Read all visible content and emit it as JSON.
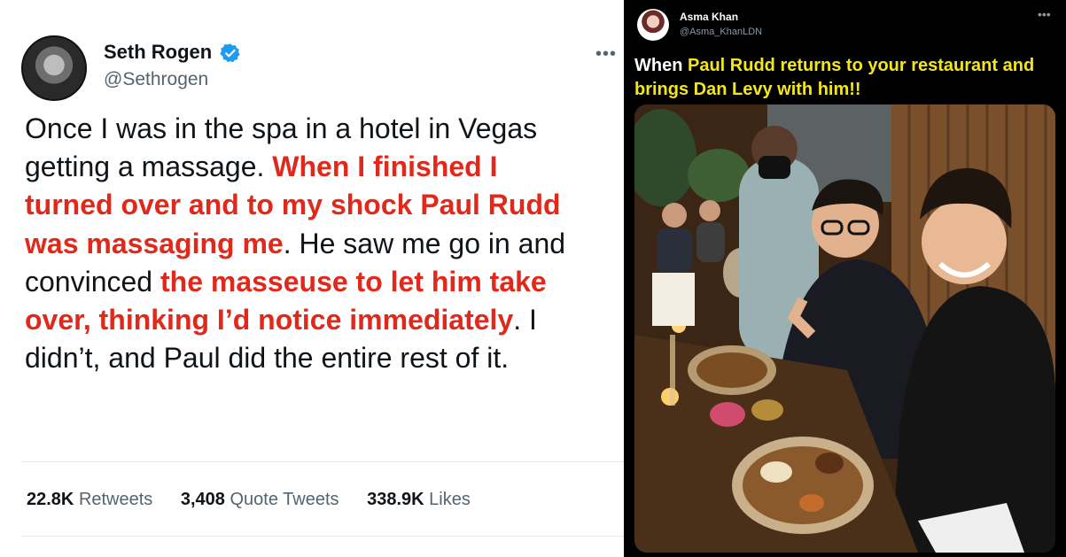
{
  "left_tweet": {
    "author_name": "Seth Rogen",
    "handle": "@Sethrogen",
    "more_glyph": "•••",
    "text_segments": [
      {
        "text": "Once I was in the spa in a hotel in Vegas getting a massage. ",
        "highlight": false
      },
      {
        "text": "When I finished I turned over and to my shock Paul Rudd was massaging me",
        "highlight": true
      },
      {
        "text": ". He saw me go in and convinced ",
        "highlight": false
      },
      {
        "text": "the masseuse to let him take over, thinking I’d notice immediately",
        "highlight": true
      },
      {
        "text": ". I didn’t, and Paul did the entire rest of it.",
        "highlight": false
      }
    ],
    "stats": [
      {
        "value": "22.8K",
        "label": "Retweets"
      },
      {
        "value": "3,408",
        "label": "Quote Tweets"
      },
      {
        "value": "338.9K",
        "label": "Likes"
      }
    ]
  },
  "right_tweet": {
    "author_name": "Asma Khan",
    "handle": "@Asma_KhanLDN",
    "more_glyph": "•••",
    "caption": {
      "prefix": "When ",
      "highlight": "Paul Rudd returns to your restaurant and brings Dan Levy with him!!"
    }
  },
  "colors": {
    "highlight_red": "#e0281b",
    "highlight_yellow": "#f3e61a",
    "verified_blue": "#1d9bf0"
  }
}
